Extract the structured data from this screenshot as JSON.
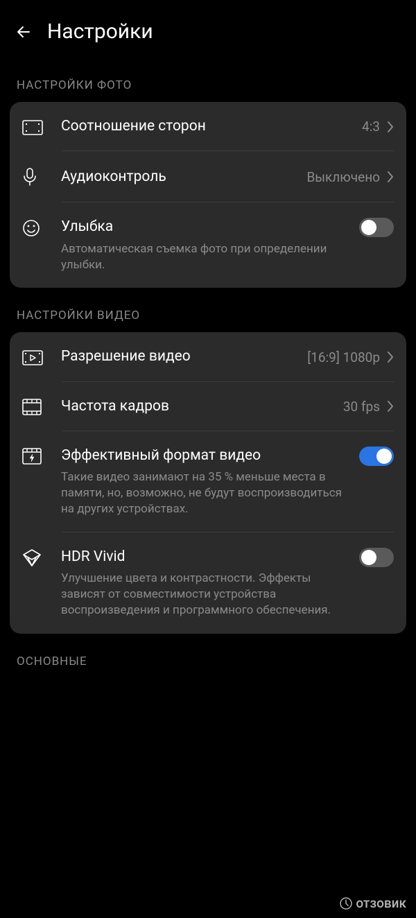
{
  "header": {
    "title": "Настройки"
  },
  "sections": {
    "photo": {
      "header": "НАСТРОЙКИ ФОТО",
      "aspect_ratio": {
        "label": "Соотношение сторон",
        "value": "4:3"
      },
      "audio_control": {
        "label": "Аудиоконтроль",
        "value": "Выключено"
      },
      "smile": {
        "label": "Улыбка",
        "subtitle": "Автоматическая съемка фото при определении улыбки.",
        "enabled": false
      }
    },
    "video": {
      "header": "НАСТРОЙКИ ВИДЕО",
      "resolution": {
        "label": "Разрешение видео",
        "value": "[16:9] 1080p"
      },
      "framerate": {
        "label": "Частота кадров",
        "value": "30 fps"
      },
      "efficient_format": {
        "label": "Эффективный формат видео",
        "subtitle": "Такие видео занимают на 35 % меньше места в памяти, но, возможно, не будут воспроизводиться на других устройствах.",
        "enabled": true
      },
      "hdr_vivid": {
        "label": "HDR Vivid",
        "subtitle": "Улучшение цвета и контрастности. Эффекты зависят от совместимости устройства воспроизведения и программного обеспечения.",
        "enabled": false
      }
    },
    "main": {
      "header": "ОСНОВНЫЕ"
    }
  },
  "watermark": {
    "text": "отзовик"
  }
}
